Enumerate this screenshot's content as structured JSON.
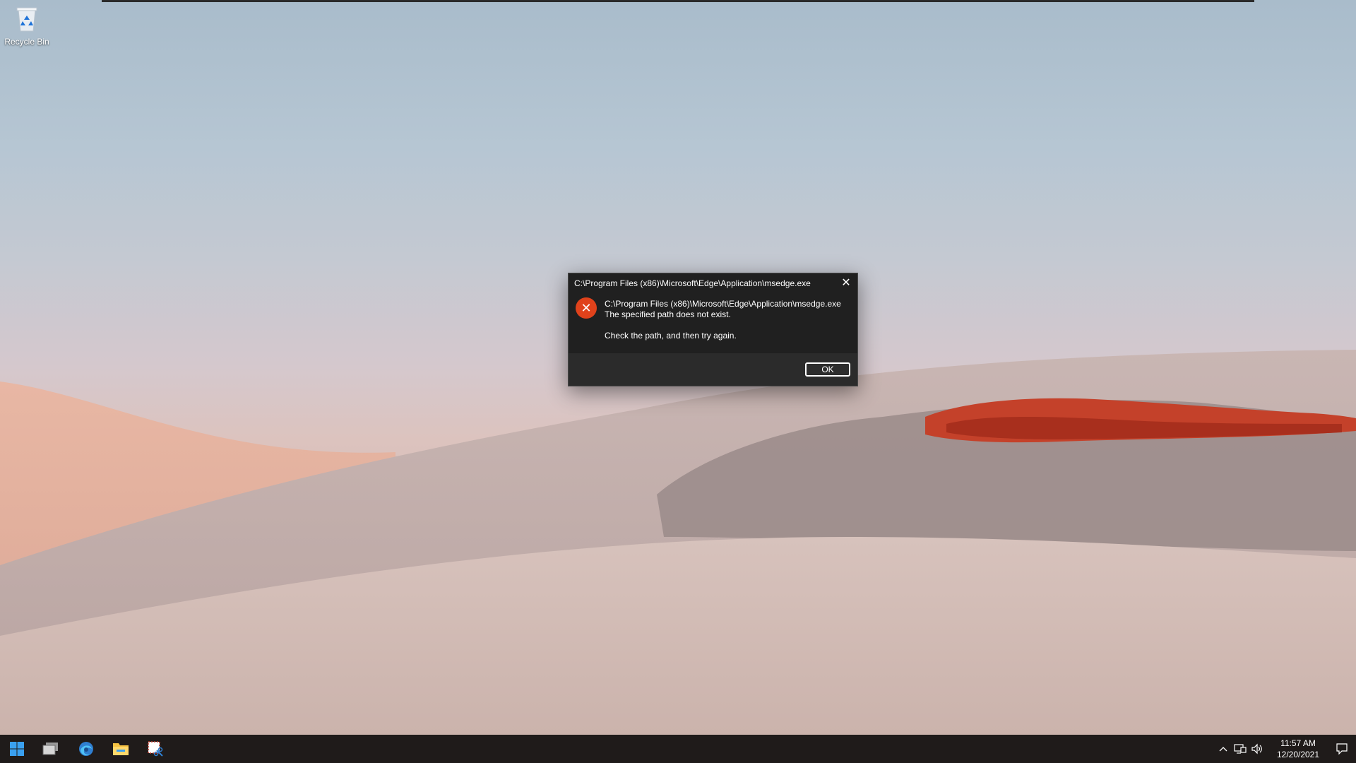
{
  "desktop": {
    "icons": [
      {
        "label": "Recycle Bin",
        "icon": "recycle-bin-icon"
      }
    ]
  },
  "dialog": {
    "title": "C:\\Program Files (x86)\\Microsoft\\Edge\\Application\\msedge.exe",
    "close_glyph": "✕",
    "icon": "error-icon",
    "message_line1": "C:\\Program Files (x86)\\Microsoft\\Edge\\Application\\msedge.exe",
    "message_line2": "The specified path does not exist.",
    "message_line3": "Check the path, and then try again.",
    "ok_label": "OK",
    "colors": {
      "background": "#2b2b2b",
      "error_red": "#e0421b",
      "text": "#ffffff"
    }
  },
  "taskbar": {
    "items": [
      "start-icon",
      "task-view-icon",
      "edge-icon",
      "file-explorer-icon",
      "snipping-tool-icon"
    ],
    "tray": {
      "icons": [
        "chevron-up-icon",
        "network-icon",
        "volume-icon",
        "notification-icon"
      ],
      "time": "11:57 AM",
      "date": "12/20/2021"
    },
    "colors": {
      "background": "#1f1b1a"
    }
  }
}
